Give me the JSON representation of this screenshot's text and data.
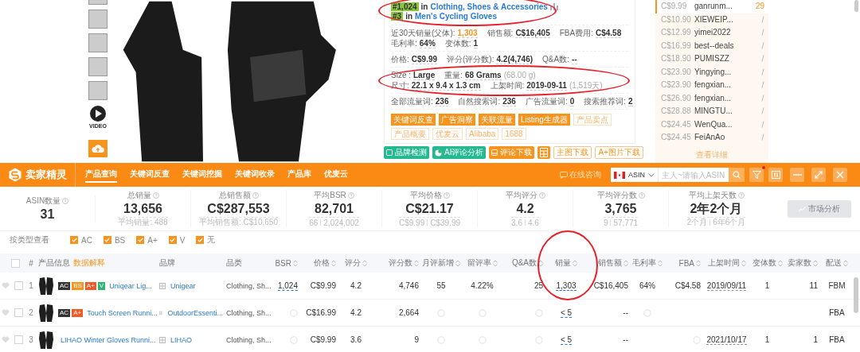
{
  "thumbnails": [
    {
      "kind": "photo"
    },
    {
      "kind": "photo"
    },
    {
      "kind": "photo"
    },
    {
      "kind": "photo"
    },
    {
      "kind": "photo"
    },
    {
      "kind": "video",
      "label": "VIDEO"
    },
    {
      "kind": "upload"
    }
  ],
  "product": {
    "ranks_circled": true,
    "ranks": [
      {
        "rank": "#1,024",
        "preposition": "in",
        "category": "Clothing, Shoes & Accessories",
        "chart": true
      },
      {
        "rank": "#3",
        "preposition": "in",
        "category": "Men's Cycling Gloves",
        "chart": false
      }
    ],
    "groups": [
      {
        "circled": false,
        "lines": [
          [
            {
              "label": "近30天销量(父体):",
              "value": "1,303",
              "highlighted": true
            },
            {
              "label": "销售额:",
              "value": "C$16,405",
              "highlighted": false
            },
            {
              "label": "FBA费用:",
              "value": "C$4.58",
              "highlighted": false
            }
          ],
          [
            {
              "label": "毛利率:",
              "value": "64%",
              "highlighted": false
            },
            {
              "label": "变体数:",
              "value": "1",
              "highlighted": false
            }
          ]
        ]
      },
      {
        "circled": false,
        "lines": [
          [
            {
              "label": "价格:",
              "value": "C$9.99",
              "highlighted": false
            },
            {
              "label": "评分(评分数):",
              "value": "4.2(4,746)",
              "highlighted": false
            },
            {
              "label": "Q&A数:",
              "value": "--",
              "highlighted": false
            }
          ]
        ]
      },
      {
        "circled": true,
        "lines": [
          [
            {
              "label": "Size :",
              "value": "Large",
              "highlighted": false
            },
            {
              "label": "重量:",
              "value": "68 Grams",
              "note": "(68.00 g)",
              "highlighted": false
            }
          ],
          [
            {
              "label": "尺寸:",
              "value": "22.1 x 9.4 x 1.3 cm",
              "highlighted": false
            },
            {
              "label": "上架时间:",
              "value": "2019-09-11",
              "note": "(1,519天)",
              "highlighted": false
            }
          ]
        ]
      },
      {
        "circled": false,
        "lines": [
          [
            {
              "label": "全部流量词:",
              "value": "236",
              "highlighted": false
            },
            {
              "label": "自然搜索词:",
              "value": "236",
              "highlighted": false
            },
            {
              "label": "广告流量词:",
              "value": "0",
              "highlighted": false
            },
            {
              "label": "搜索推荐词:",
              "value": "2",
              "highlighted": false
            }
          ]
        ]
      }
    ],
    "tags": [
      {
        "label": "关键词反查",
        "kind": "solid"
      },
      {
        "label": "广告洞察",
        "kind": "solid"
      },
      {
        "label": "关联流量",
        "kind": "solid"
      },
      {
        "label": "Listing生成器",
        "kind": "solid"
      },
      {
        "label": "产品卖点",
        "kind": "outline"
      },
      {
        "label": "产品概要",
        "kind": "outline"
      },
      {
        "label": "优麦云",
        "kind": "outline"
      },
      {
        "label": "Alibaba",
        "kind": "outline"
      },
      {
        "label": "1688",
        "kind": "outline"
      }
    ],
    "actions": [
      {
        "label": "品牌检测",
        "kind": "green"
      },
      {
        "label": "AI评论分析",
        "kind": "green"
      },
      {
        "label": "评论下载",
        "kind": "orange"
      },
      {
        "kind": "grid"
      },
      {
        "label": "主图下载",
        "kind": "outline"
      },
      {
        "label": "A+图片下载",
        "kind": "outline"
      }
    ]
  },
  "sellers": {
    "items": [
      {
        "price": "C$9.99",
        "name": "ganrunm...",
        "count": "29",
        "selected": true
      },
      {
        "price": "C$10.90",
        "name": "XIEWEIP...",
        "selected": false
      },
      {
        "price": "C$12.99",
        "name": "yimei2022",
        "selected": false
      },
      {
        "price": "C$16.99",
        "name": "best--deals",
        "selected": false
      },
      {
        "price": "C$18.90",
        "name": "PUMISZZ",
        "selected": false
      },
      {
        "price": "C$23.90",
        "name": "Yingying...",
        "selected": false
      },
      {
        "price": "C$23.90",
        "name": "fengxian...",
        "selected": false
      },
      {
        "price": "C$26.90",
        "name": "fengxian...",
        "selected": false
      },
      {
        "price": "C$28.88",
        "name": "MINGTU...",
        "selected": false
      },
      {
        "price": "C$24.45",
        "name": "WenQua...",
        "selected": false
      },
      {
        "price": "C$24.45",
        "name": "FeiAnAo",
        "selected": false
      }
    ],
    "more": "查看详细"
  },
  "toolbar": {
    "brand": "卖家精灵",
    "nav": [
      {
        "label": "产品查询",
        "selected": true
      },
      {
        "label": "关键词反查",
        "selected": false
      },
      {
        "label": "关键词挖掘",
        "selected": false
      },
      {
        "label": "关键词收录",
        "selected": false
      },
      {
        "label": "产品库",
        "selected": false
      },
      {
        "label": "优麦云",
        "selected": false
      }
    ],
    "consult": "在线咨询",
    "search_type": "ASIN",
    "search": {
      "placeholder": "主人~请输入ASIN"
    },
    "filter_notification": true
  },
  "stats": [
    {
      "label": "ASIN数量",
      "value": "31"
    },
    {
      "label": "总销量",
      "value": "13,656",
      "sub": [
        "平均销量: 488"
      ]
    },
    {
      "label": "总销售额",
      "value": "C$287,553",
      "sub": [
        "平均销售额: C$10,650"
      ]
    },
    {
      "label": "平均BSR",
      "value": "82,701",
      "sub": [
        "66",
        "2,024,002"
      ]
    },
    {
      "label": "平均价格",
      "value": "C$21.17",
      "sub": [
        "C$9.99",
        "C$39.99"
      ]
    },
    {
      "label": "平均评分",
      "value": "4.2",
      "sub": [
        "3.6",
        "4.6"
      ]
    },
    {
      "label": "平均评分数",
      "value": "3,765",
      "sub": [
        "9",
        "57,771"
      ]
    },
    {
      "label": "平均上架天数",
      "value": "2年2个月",
      "sub": [
        "2个月",
        "6年6个月"
      ]
    }
  ],
  "market_analysis": {
    "label": "市场分析",
    "disabled": true
  },
  "type_filter": {
    "label": "按类型查看",
    "options": [
      {
        "label": "AC",
        "checked": true
      },
      {
        "label": "BS",
        "checked": true
      },
      {
        "label": "A+",
        "checked": true
      },
      {
        "label": "V",
        "checked": true
      },
      {
        "label": "无",
        "checked": true
      }
    ]
  },
  "table": {
    "header_checked": false,
    "index_label": "#",
    "product_label": "产品信息",
    "explain_link": "数据解释",
    "brand_label": "品牌",
    "category_label": "品类",
    "columns": [
      {
        "label": "BSR",
        "circled": false
      },
      {
        "label": "价格",
        "circled": false
      },
      {
        "label": "评分",
        "circled": false
      },
      {
        "label": "评分数",
        "circled": false
      },
      {
        "label": "月评新增",
        "circled": false
      },
      {
        "label": "留评率",
        "circled": false
      },
      {
        "label": "Q&A数",
        "circled": false
      },
      {
        "label": "销量",
        "circled": true
      },
      {
        "label": "销售额",
        "circled": false
      },
      {
        "label": "毛利率",
        "circled": false
      },
      {
        "label": "FBA",
        "circled": false
      },
      {
        "label": "上架时间",
        "circled": false
      },
      {
        "label": "变体数",
        "circled": false
      },
      {
        "label": "卖家数",
        "circled": false
      },
      {
        "label": "配送",
        "circled": false
      }
    ],
    "rows": [
      {
        "checked": false,
        "index": "1",
        "badges": [
          {
            "label": "AC",
            "color": "#333333"
          },
          {
            "label": "BS",
            "color": "#f7941d"
          },
          {
            "label": "A+",
            "color": "#f05a28"
          },
          {
            "label": "V",
            "color": "#2bb673"
          }
        ],
        "title": "Uniqear Lig...",
        "brand": "Unigear",
        "category": "Clothing, Sh...",
        "cells": [
          "1,024",
          "C$9.99",
          "4.2",
          "4,746",
          "55",
          "4.22%",
          "25",
          "1,303",
          "C$16,405",
          "64%",
          "C$4.58",
          "2019/09/11",
          "1",
          "11",
          "FBM"
        ]
      },
      {
        "checked": false,
        "index": "2",
        "badges": [
          {
            "label": "AC",
            "color": "#333333"
          },
          {
            "label": "A+",
            "color": "#f05a28"
          }
        ],
        "title": "Touch Screen Runni...",
        "brand": "OutdoorEssenti...",
        "category": "Clothing, Sh...",
        "cells": [
          {
            "kind": "loading"
          },
          "C$16.99",
          "4.2",
          "2,664",
          {
            "kind": "loading"
          },
          {
            "kind": "loading"
          },
          {
            "kind": "loading"
          },
          "< 5",
          "--",
          {
            "kind": "loading"
          },
          null,
          null,
          null,
          null,
          "FBA"
        ]
      },
      {
        "checked": false,
        "index": "3",
        "badges": [],
        "title": "LIHAO Winter Gloves Runni...",
        "brand": "LIHAO",
        "category": "Clothing, Sh...",
        "cells": [
          {
            "kind": "loading"
          },
          "C$9.99",
          "3.6",
          "9",
          {
            "kind": "loading"
          },
          {
            "kind": "loading"
          },
          {
            "kind": "loading"
          },
          "< 5",
          "--",
          null,
          {
            "kind": "loading"
          },
          "2021/10/17",
          "1",
          "1",
          "FBA"
        ]
      }
    ]
  }
}
